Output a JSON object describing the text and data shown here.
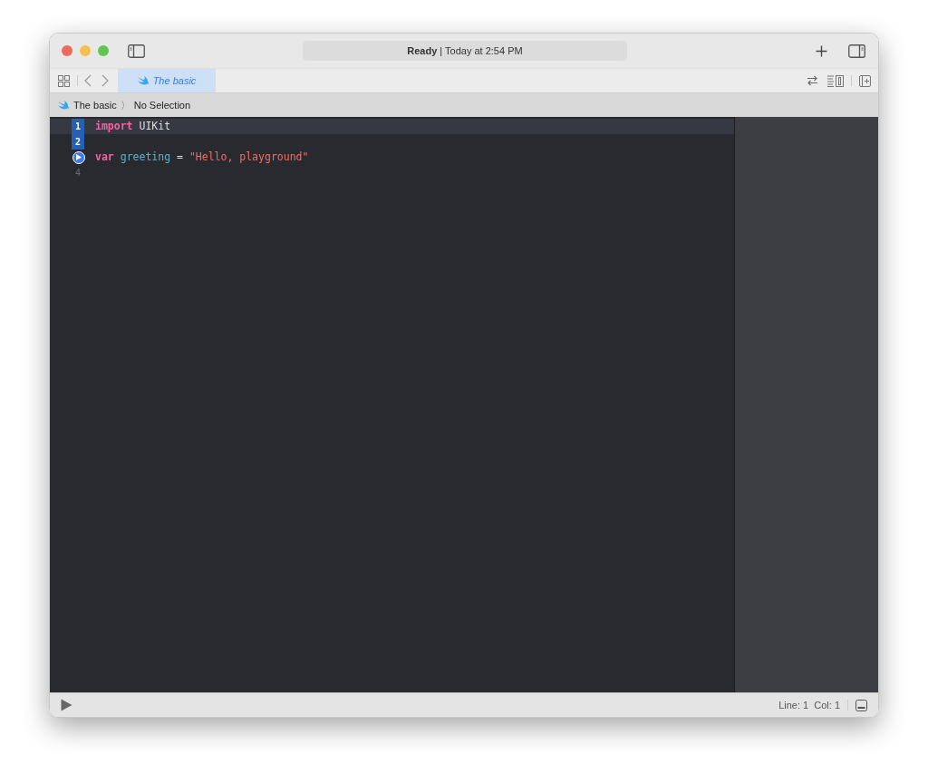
{
  "toolbar": {
    "status_bold": "Ready",
    "status_text": "| Today at 2:54 PM"
  },
  "tabs": [
    {
      "label": "The basic",
      "selected": true
    }
  ],
  "jump_bar": {
    "file": "The basic",
    "separator": "〉",
    "selection": "No Selection"
  },
  "editor": {
    "lines": [
      {
        "kind": "executed",
        "number": "1",
        "current": true,
        "tokens": [
          {
            "kind": "keyword",
            "text": "import"
          },
          {
            "kind": "plain",
            "text": " UIKit"
          }
        ]
      },
      {
        "kind": "executed",
        "number": "2",
        "current": false
      },
      {
        "kind": "run",
        "current": false,
        "tokens": [
          {
            "kind": "keyword",
            "text": "var"
          },
          {
            "kind": "identifier",
            "text": " greeting"
          },
          {
            "kind": "plain",
            "text": " = "
          },
          {
            "kind": "string",
            "text": "\"Hello, playground\""
          }
        ]
      },
      {
        "kind": "plain",
        "number": "4",
        "current": false
      }
    ]
  },
  "status_bar": {
    "position": "Line: 1  Col: 1"
  }
}
